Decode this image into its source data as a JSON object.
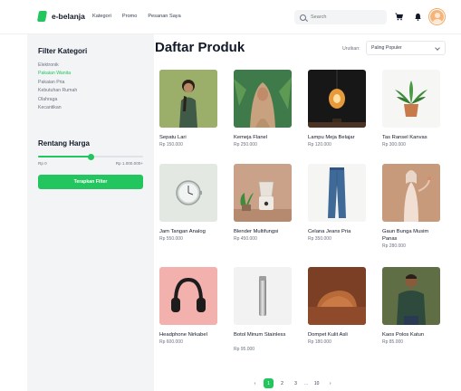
{
  "brand": {
    "name": "e-belanja",
    "accent": "#22c55e"
  },
  "nav": [
    "Kategori",
    "Promo",
    "Pesanan Saya"
  ],
  "search": {
    "placeholder": "Search"
  },
  "icons": {
    "search": "search-icon",
    "cart": "cart-icon",
    "bell": "bell-icon",
    "user": "avatar"
  },
  "sidebar": {
    "filter_title": "Filter Kategori",
    "categories": [
      {
        "label": "Elektronik",
        "active": false
      },
      {
        "label": "Pakaian Wanita",
        "active": true
      },
      {
        "label": "Pakaian Pria",
        "active": false
      },
      {
        "label": "Kebutuhan Rumah",
        "active": false
      },
      {
        "label": "Olahraga",
        "active": false
      },
      {
        "label": "Kecantikan",
        "active": false
      }
    ],
    "price_title": "Rentang Harga",
    "price_min_label": "Rp 0",
    "price_max_label": "Rp 1.000.000+",
    "slider_value_fraction": 0.5,
    "apply_label": "Terapkan Filter"
  },
  "main": {
    "title": "Daftar Produk",
    "sort_label": "Urutkan:",
    "sort_value": "Paling Populer"
  },
  "products": [
    {
      "name": "Sepatu Lari",
      "price": "Rp 150.000"
    },
    {
      "name": "Kemeja Flanel",
      "price": "Rp 250.000"
    },
    {
      "name": "Lampu Meja Belajar",
      "price": "Rp 120.000"
    },
    {
      "name": "Tas Ransel Kanvas",
      "price": "Rp 300.000"
    },
    {
      "name": "Jam Tangan Analog",
      "price": "Rp 550.000"
    },
    {
      "name": "Blender Multifungsi",
      "price": "Rp 450.000"
    },
    {
      "name": "Celana Jeans Pria",
      "price": "Rp 350.000"
    },
    {
      "name": "Gaun Bunga Musim Panas",
      "price": "Rp 280.000"
    },
    {
      "name": "Headphone Nirkabel",
      "price": "Rp 600.000"
    },
    {
      "name": "Botol Minum Stainless",
      "price": "Rp 95.000"
    },
    {
      "name": "Dompet Kulit Asli",
      "price": "Rp 180.000"
    },
    {
      "name": "Kaos Polos Katun",
      "price": "Rp 85.000"
    }
  ],
  "pagination": {
    "prev": "‹",
    "pages": [
      "1",
      "2",
      "3"
    ],
    "ellipsis": "...",
    "last": "10",
    "next": "›",
    "current": "1"
  }
}
